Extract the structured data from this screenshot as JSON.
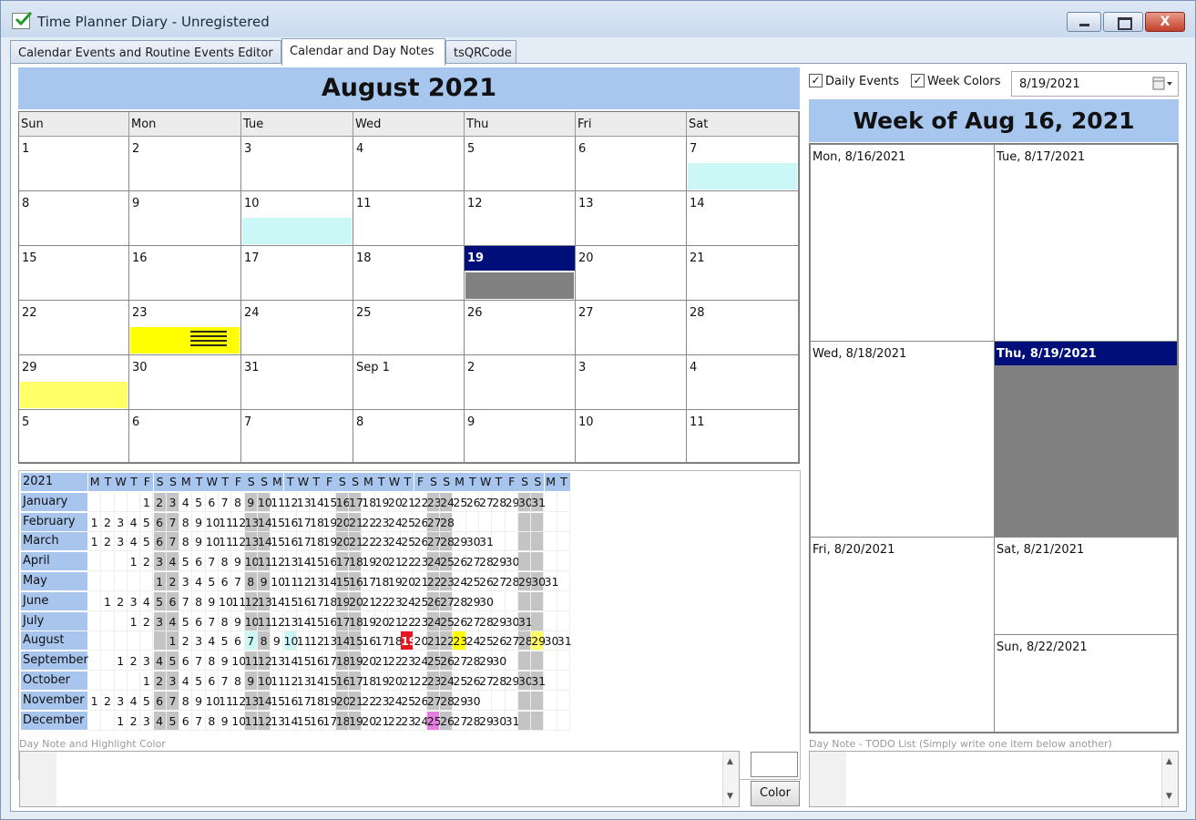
{
  "window": {
    "title": "Time Planner Diary - Unregistered",
    "close_glyph": "X"
  },
  "tabs": [
    {
      "label": "Calendar Events and Routine Events Editor"
    },
    {
      "label": "Calendar and Day Notes"
    },
    {
      "label": "tsQRCode"
    }
  ],
  "month": {
    "title": "August 2021",
    "weekdays": [
      "Sun",
      "Mon",
      "Tue",
      "Wed",
      "Thu",
      "Fri",
      "Sat"
    ],
    "weeks": [
      [
        "1",
        "2",
        "3",
        "4",
        "5",
        "6",
        "7"
      ],
      [
        "8",
        "9",
        "10",
        "11",
        "12",
        "13",
        "14"
      ],
      [
        "15",
        "16",
        "17",
        "18",
        "19",
        "20",
        "21"
      ],
      [
        "22",
        "23",
        "24",
        "25",
        "26",
        "27",
        "28"
      ],
      [
        "29",
        "30",
        "31",
        "Sep 1",
        "2",
        "3",
        "4"
      ],
      [
        "5",
        "6",
        "7",
        "8",
        "9",
        "10",
        "11"
      ]
    ],
    "selected_day": "19",
    "highlights": [
      {
        "week": 0,
        "day": 6,
        "color": "#ccf7f7"
      },
      {
        "week": 1,
        "day": 2,
        "color": "#ccf7f7"
      },
      {
        "week": 2,
        "day": 4,
        "color": "#808080"
      },
      {
        "week": 3,
        "day": 1,
        "color": "#ffff00",
        "has_note": true
      },
      {
        "week": 4,
        "day": 0,
        "color": "#ffff66"
      }
    ],
    "colors": {
      "selected": "#000e7a",
      "header": "#a7c7ee"
    }
  },
  "year_view": {
    "year_label": "2021",
    "header_letters": [
      "M",
      "T",
      "W",
      "T",
      "F",
      "S",
      "S",
      "M",
      "T",
      "W",
      "T",
      "F",
      "S",
      "S",
      "M",
      "T",
      "W",
      "T",
      "F",
      "S",
      "S",
      "M",
      "T",
      "W",
      "T",
      "F",
      "S",
      "S",
      "M",
      "T",
      "W",
      "T",
      "F",
      "S",
      "S",
      "M",
      "T"
    ],
    "months": [
      {
        "name": "January",
        "offset": 4,
        "days": 31
      },
      {
        "name": "February",
        "offset": 0,
        "days": 28
      },
      {
        "name": "March",
        "offset": 0,
        "days": 31
      },
      {
        "name": "April",
        "offset": 3,
        "days": 30
      },
      {
        "name": "May",
        "offset": 5,
        "days": 31
      },
      {
        "name": "June",
        "offset": 1,
        "days": 30
      },
      {
        "name": "July",
        "offset": 3,
        "days": 31
      },
      {
        "name": "August",
        "offset": 6,
        "days": 31
      },
      {
        "name": "September",
        "offset": 2,
        "days": 30
      },
      {
        "name": "October",
        "offset": 4,
        "days": 31
      },
      {
        "name": "November",
        "offset": 0,
        "days": 30
      },
      {
        "name": "December",
        "offset": 2,
        "days": 31
      }
    ],
    "marked_days": [
      {
        "month": 7,
        "day": 7,
        "color": "#ccf7f7"
      },
      {
        "month": 7,
        "day": 10,
        "color": "#ccf7f7"
      },
      {
        "month": 7,
        "day": 19,
        "color": "#e8141e",
        "text_color": "#ffffff"
      },
      {
        "month": 7,
        "day": 23,
        "color": "#ffff00"
      },
      {
        "month": 7,
        "day": 29,
        "color": "#ffff66"
      },
      {
        "month": 11,
        "day": 25,
        "color": "#e77ce0"
      }
    ]
  },
  "day_note": {
    "caption": "Day Note and Highlight Color",
    "value": "",
    "color_button": "Color"
  },
  "week_panel": {
    "daily_events_label": "Daily Events",
    "daily_events_checked": true,
    "week_colors_label": "Week Colors",
    "week_colors_checked": true,
    "check_glyph": "✓",
    "date_value": "8/19/2021",
    "title": "Week of Aug 16, 2021",
    "days": [
      {
        "label": "Mon, 8/16/2021"
      },
      {
        "label": "Tue, 8/17/2021"
      },
      {
        "label": "Wed, 8/18/2021"
      },
      {
        "label": "Thu, 8/19/2021",
        "selected": true
      },
      {
        "label": "Fri, 8/20/2021"
      },
      {
        "label": "Sat, 8/21/2021"
      },
      {
        "label": "Sun, 8/22/2021"
      }
    ]
  },
  "todo": {
    "caption": "Day Note - TODO List (Simply write one item below another)",
    "value": ""
  },
  "scroll_glyphs": {
    "up": "▲",
    "down": "▼"
  }
}
